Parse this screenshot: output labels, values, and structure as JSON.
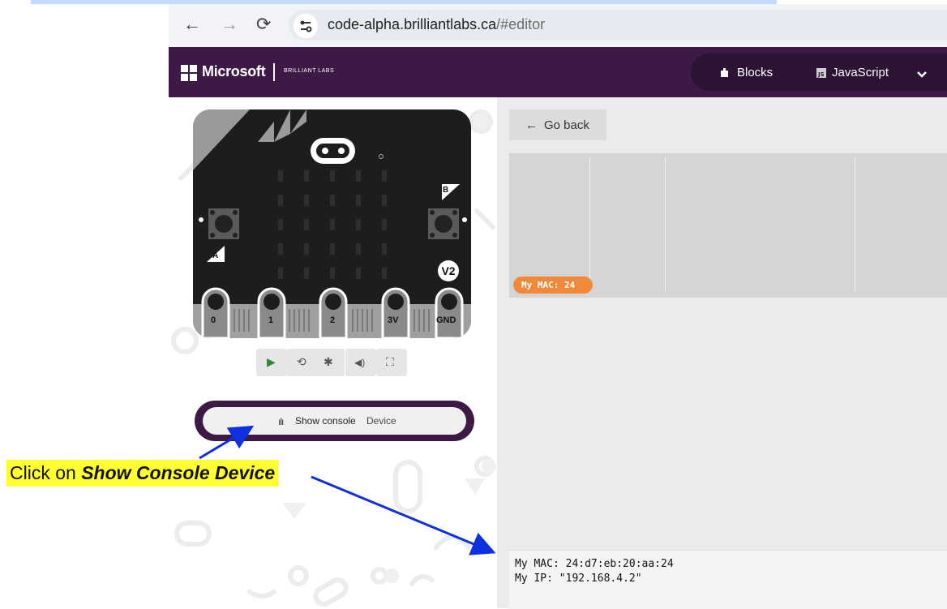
{
  "browser": {
    "url_host": "code-alpha.brilliantlabs.ca",
    "url_path": "/#editor"
  },
  "appbar": {
    "brand": "Microsoft",
    "partner_logo": "BRILLIANT LABS",
    "tabs": [
      {
        "label": "Blocks",
        "icon": "puzzle-icon"
      },
      {
        "label": "JavaScript",
        "icon": "js-icon"
      }
    ]
  },
  "simulator": {
    "board_version": "V2",
    "button_a": "A",
    "button_b": "B",
    "pins": [
      "0",
      "1",
      "2",
      "3V",
      "GND"
    ],
    "controls": [
      "play-icon",
      "restart-icon",
      "debug-icon",
      "sound-icon",
      "fullscreen-icon"
    ],
    "console_button": {
      "label": "Show console",
      "sub_label": "Device"
    }
  },
  "editor": {
    "go_back": "Go back",
    "serial_chart_label": "My MAC: 24",
    "console_lines": [
      "My MAC: 24:d7:eb:20:aa:24",
      "My IP: \"192.168.4.2\""
    ]
  },
  "annotation": {
    "prefix": "Click on ",
    "emphasis": "Show Console Device"
  },
  "colors": {
    "appbar": "#3d1a45",
    "accent_pill": "#f2893a",
    "callout_highlight": "#ffff33",
    "arrow": "#1030e0"
  }
}
